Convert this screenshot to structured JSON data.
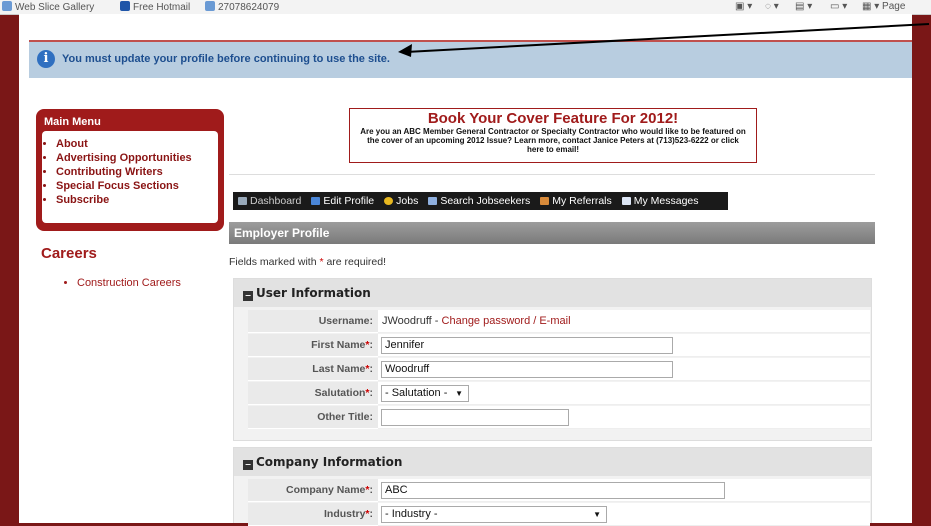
{
  "browser": {
    "favorites": [
      "Web Slice Gallery",
      "Free Hotmail",
      "27078624079"
    ],
    "right_toolbar": "Page"
  },
  "notice": {
    "message": "You must update your profile before continuing to use the site."
  },
  "main_menu": {
    "title": "Main Menu",
    "items": [
      "About",
      "Advertising Opportunities",
      "Contributing Writers",
      "Special Focus Sections",
      "Subscribe"
    ]
  },
  "careers": {
    "title": "Careers",
    "items": [
      "Construction Careers"
    ]
  },
  "banner": {
    "headline": "Book Your Cover Feature For 2012!",
    "body": "Are you an ABC Member General Contractor or Specialty Contractor who would like to be featured on the cover of an upcoming 2012 Issue? Learn more, contact Janice Peters at (713)523-6222 or click here to email!"
  },
  "tabs": [
    "Dashboard",
    "Edit Profile",
    "Jobs",
    "Search Jobseekers",
    "My Referrals",
    "My Messages"
  ],
  "profile": {
    "title": "Employer Profile",
    "required_note_prefix": "Fields marked with ",
    "required_star": "*",
    "required_note_suffix": " are required!"
  },
  "user_info": {
    "title": "User Information",
    "username_label": "Username:",
    "username_value": "JWoodruff",
    "username_sep": " - ",
    "change_link": "Change password / E-mail",
    "first_name_label": "First Name",
    "first_name_value": "Jennifer",
    "last_name_label": "Last Name",
    "last_name_value": "Woodruff",
    "salutation_label": "Salutation",
    "salutation_value": "- Salutation -",
    "other_title_label": "Other Title:",
    "other_title_value": ""
  },
  "company_info": {
    "title": "Company Information",
    "company_name_label": "Company Name",
    "company_name_value": "ABC",
    "industry_label": "Industry",
    "industry_value": "- Industry -"
  },
  "colors": {
    "brand_red": "#a01b1b",
    "notice_bg": "#b8cde0",
    "tab_bg": "#1a1a1a"
  }
}
